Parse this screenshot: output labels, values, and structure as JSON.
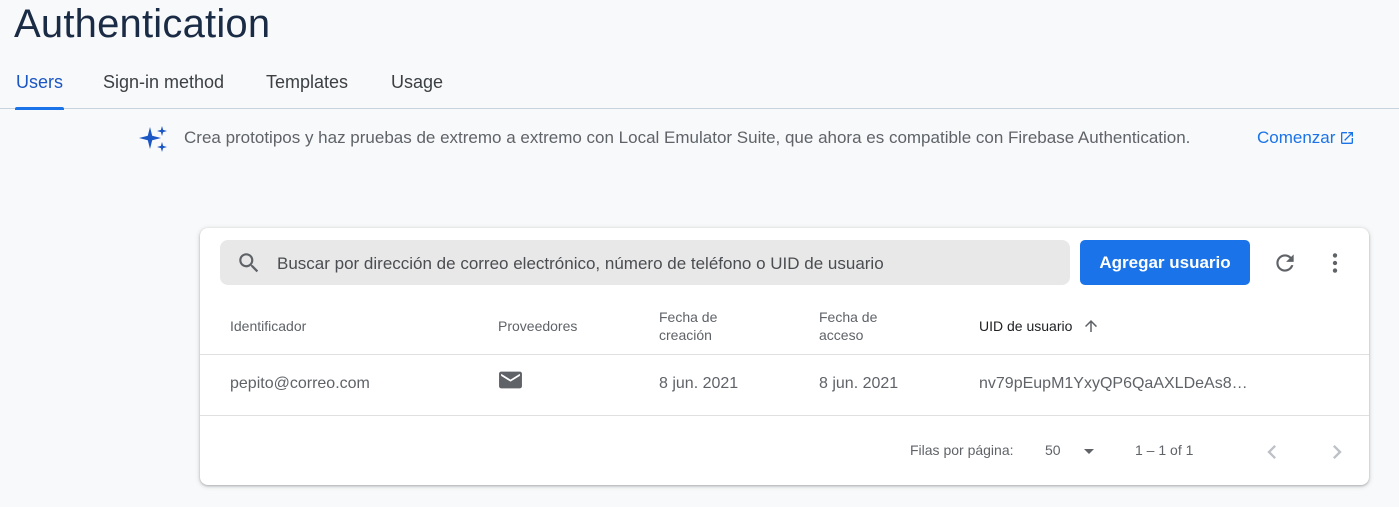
{
  "page": {
    "title": "Authentication"
  },
  "tabs": [
    {
      "label": "Users",
      "active": true
    },
    {
      "label": "Sign-in method",
      "active": false
    },
    {
      "label": "Templates",
      "active": false
    },
    {
      "label": "Usage",
      "active": false
    }
  ],
  "banner": {
    "icon": "sparkle-icon",
    "text": "Crea prototipos y haz pruebas de extremo a extremo con Local Emulator Suite, que ahora es compatible con Firebase Authentication.",
    "link_label": "Comenzar",
    "link_icon": "open-in-new-icon"
  },
  "users_table": {
    "search_placeholder": "Buscar por dirección de correo electrónico, número de teléfono o UID de usuario",
    "add_button_label": "Agregar usuario",
    "columns": {
      "identifier": "Identificador",
      "providers": "Proveedores",
      "created_line1": "Fecha de",
      "created_line2": "creación",
      "signed_in_line1": "Fecha de",
      "signed_in_line2": "acceso",
      "uid": "UID de usuario"
    },
    "rows": [
      {
        "identifier": "pepito@correo.com",
        "provider_icon": "email-icon",
        "created": "8 jun. 2021",
        "signed_in": "8 jun. 2021",
        "uid": "nv79pEupM1YxyQP6QaAXLDeAs8…"
      }
    ],
    "footer": {
      "rows_per_page_label": "Filas por página:",
      "rows_per_page_value": "50",
      "range": "1 – 1 of 1"
    }
  },
  "colors": {
    "accent": "#1a73e8",
    "title": "#1a2b45",
    "background": "#f8f9fa"
  }
}
